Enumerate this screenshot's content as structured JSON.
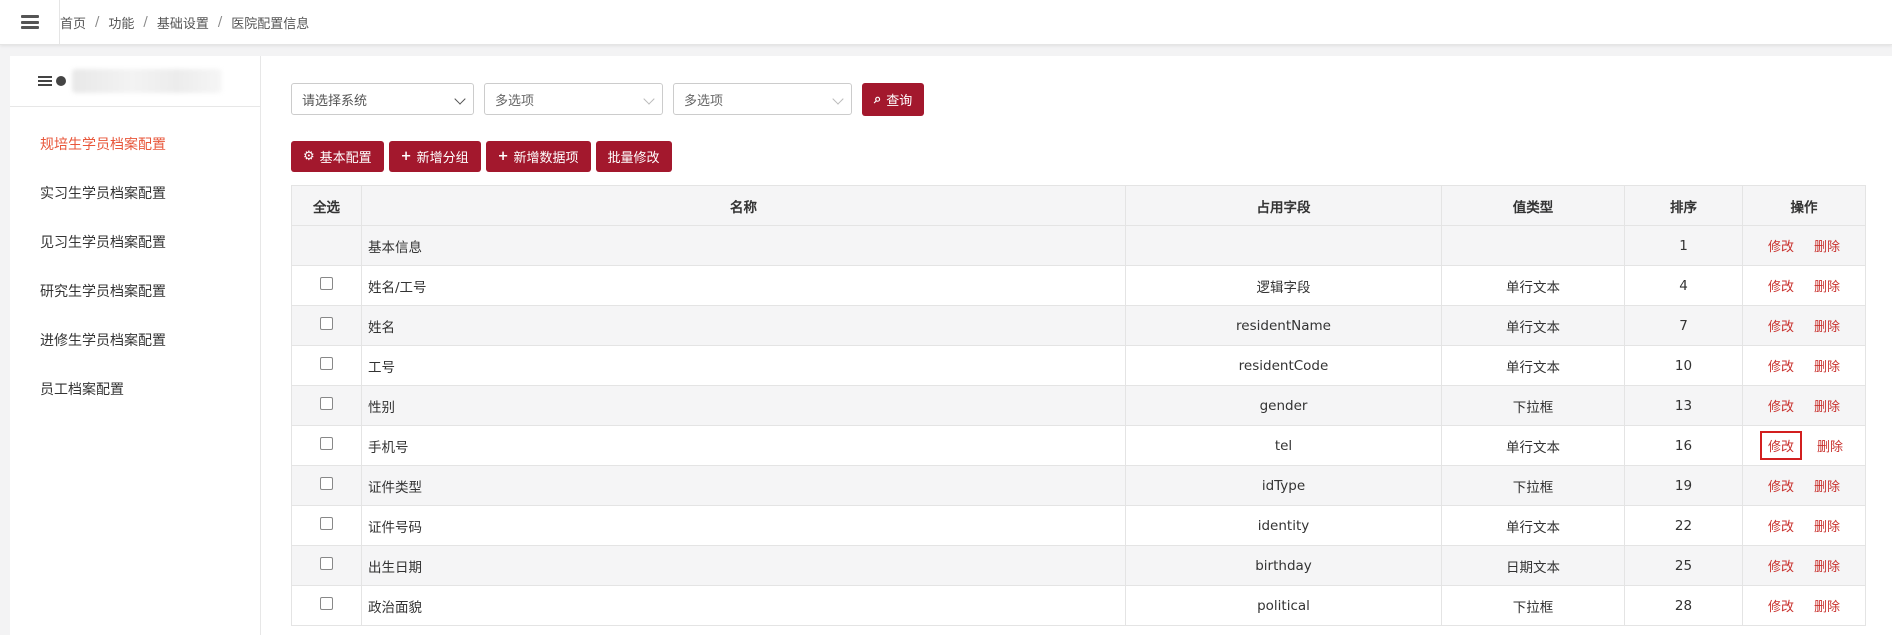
{
  "breadcrumb": [
    "首页",
    "功能",
    "基础设置",
    "医院配置信息"
  ],
  "sidebar": {
    "items": [
      {
        "label": "规培生学员档案配置",
        "active": true
      },
      {
        "label": "实习生学员档案配置",
        "active": false
      },
      {
        "label": "见习生学员档案配置",
        "active": false
      },
      {
        "label": "研究生学员档案配置",
        "active": false
      },
      {
        "label": "进修生学员档案配置",
        "active": false
      },
      {
        "label": "员工档案配置",
        "active": false
      }
    ]
  },
  "filters": {
    "system_select": "请选择系统",
    "multi_select_1": "多选项",
    "multi_select_2": "多选项",
    "query_label": "查询"
  },
  "actions": {
    "basic_config": "基本配置",
    "add_group": "新增分组",
    "add_data_item": "新增数据项",
    "batch_edit": "批量修改"
  },
  "table": {
    "headers": [
      "全选",
      "名称",
      "占用字段",
      "值类型",
      "排序",
      "操作"
    ],
    "edit_label": "修改",
    "delete_label": "删除",
    "rows": [
      {
        "name": "基本信息",
        "field": "",
        "type": "",
        "order": "1",
        "group": true
      },
      {
        "name": "姓名/工号",
        "field": "逻辑字段",
        "type": "单行文本",
        "order": "4",
        "group": false
      },
      {
        "name": "姓名",
        "field": "residentName",
        "type": "单行文本",
        "order": "7",
        "group": false
      },
      {
        "name": "工号",
        "field": "residentCode",
        "type": "单行文本",
        "order": "10",
        "group": false
      },
      {
        "name": "性别",
        "field": "gender",
        "type": "下拉框",
        "order": "13",
        "group": false
      },
      {
        "name": "手机号",
        "field": "tel",
        "type": "单行文本",
        "order": "16",
        "group": false,
        "highlight_edit": true
      },
      {
        "name": "证件类型",
        "field": "idType",
        "type": "下拉框",
        "order": "19",
        "group": false
      },
      {
        "name": "证件号码",
        "field": "identity",
        "type": "单行文本",
        "order": "22",
        "group": false
      },
      {
        "name": "出生日期",
        "field": "birthday",
        "type": "日期文本",
        "order": "25",
        "group": false
      },
      {
        "name": "政治面貌",
        "field": "political",
        "type": "下拉框",
        "order": "28",
        "group": false
      }
    ]
  },
  "colors": {
    "brand": "#a3182d",
    "active_nav": "#e8563a",
    "link": "#c9302c",
    "highlight": "#d21f1f"
  }
}
